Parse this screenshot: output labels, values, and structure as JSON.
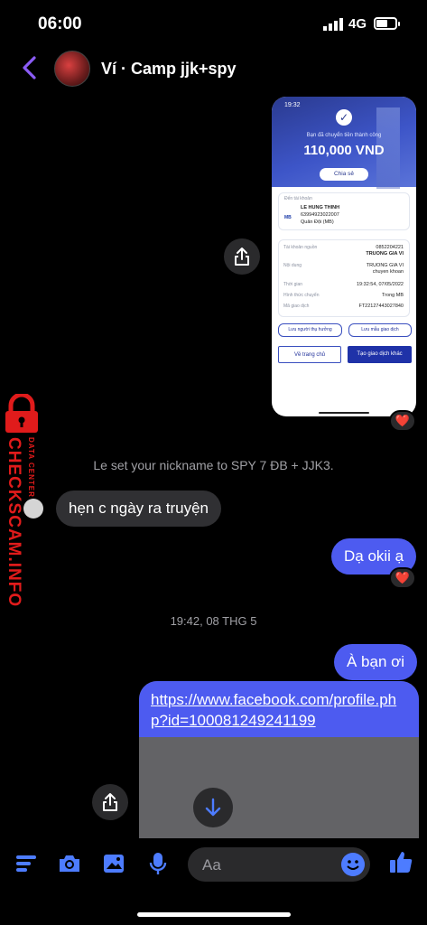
{
  "status_bar": {
    "time": "06:00",
    "network": "4G",
    "battery_level": 0.6
  },
  "header": {
    "title": "Ví · Camp jjk+spy"
  },
  "transfer_screenshot": {
    "time": "19:32",
    "success_text": "Bạn đã chuyển tiền thành công",
    "amount": "110,000 VND",
    "share_label": "Chia sẻ",
    "to_account_label": "Đến tài khoản",
    "bank_logo": "MB",
    "recipient_name": "LE HUNG THINH",
    "recipient_account": "63994923022007",
    "recipient_bank": "Quân Đội (MB)",
    "source_label": "Tài khoản nguồn",
    "source_account": "0852204221",
    "source_name": "TRUONG GIA VI",
    "content_label": "Nội dung",
    "content_value_1": "TRUONG GIA VI",
    "content_value_2": "chuyen khoan",
    "time_label": "Thời gian",
    "time_value": "19:32:54, 07/05/2022",
    "method_label": "Hình thức chuyển",
    "method_value": "Trong MB",
    "txn_label": "Mã giao dịch",
    "txn_value": "FT22127443027840",
    "save_recipient": "Lưu người thụ hưởng",
    "save_template": "Lưu mẫu giao dịch",
    "home_button": "Về trang chủ",
    "new_txn_button": "Tạo giao dịch khác"
  },
  "messages": {
    "reaction_1": "❤️",
    "system_nickname": "Le set your nickname to SPY 7 ĐB + JJK3.",
    "incoming_1": "hẹn c ngày ra truyện",
    "outgoing_1": "Dạ okii ạ",
    "reaction_2": "❤️",
    "timestamp": "19:42, 08 THG 5",
    "outgoing_2": "À bạn ơi",
    "link_text": "https://www.facebook.com/profile.php?id=100081249241199"
  },
  "watermark": {
    "main": "CHECKSCAM.INFO",
    "sub": "DATA CENTER"
  },
  "composer": {
    "placeholder": "Aa"
  },
  "colors": {
    "accent": "#4d5bf0",
    "bubble_in": "#303033",
    "watermark": "#e01b1b"
  }
}
